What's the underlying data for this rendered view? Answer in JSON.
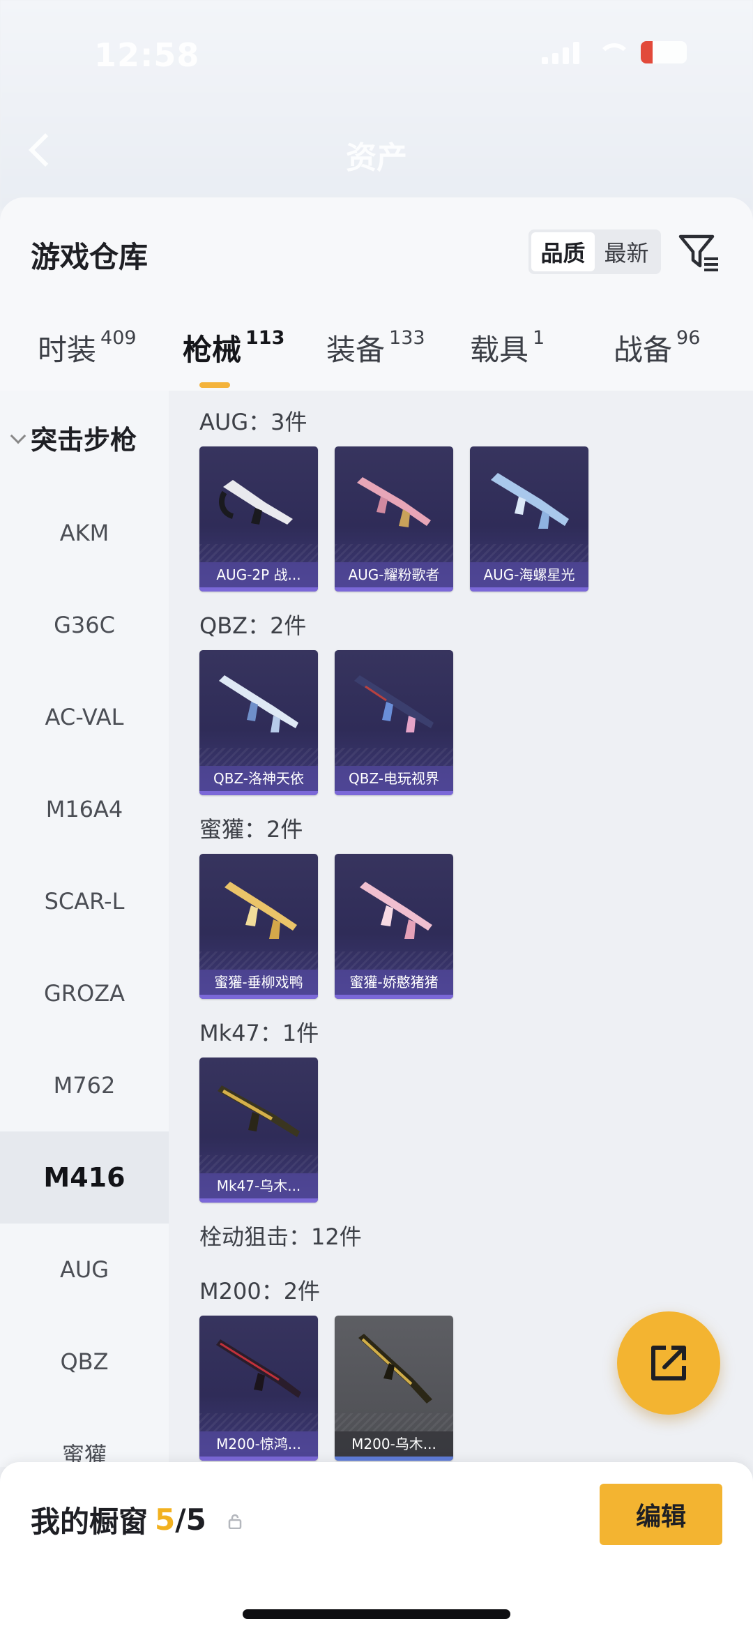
{
  "status_bar": {
    "time": "12:58",
    "battery_label": "20"
  },
  "header": {
    "title": "资产"
  },
  "sheet": {
    "title": "游戏仓库",
    "sort": {
      "options": [
        "品质",
        "最新"
      ],
      "selected": "品质"
    }
  },
  "tabs": [
    {
      "label": "时装",
      "count": "409"
    },
    {
      "label": "枪械",
      "count": "113",
      "active": true
    },
    {
      "label": "装备",
      "count": "133"
    },
    {
      "label": "载具",
      "count": "1"
    },
    {
      "label": "战备",
      "count": "96"
    }
  ],
  "sidebar": {
    "category": "突击步枪",
    "items": [
      "AKM",
      "G36C",
      "AC-VAL",
      "M16A4",
      "SCAR-L",
      "GROZA",
      "M762",
      "M416",
      "AUG",
      "QBZ",
      "蜜獾"
    ],
    "active": "M416"
  },
  "groups": [
    {
      "label": "AUG：3件",
      "items": [
        "AUG-2P 战...",
        "AUG-耀粉歌者",
        "AUG-海螺星光"
      ]
    },
    {
      "label": "QBZ：2件",
      "items": [
        "QBZ-洛神天依",
        "QBZ-电玩视界"
      ]
    },
    {
      "label": "蜜獾：2件",
      "items": [
        "蜜獾-垂柳戏鸭",
        "蜜獾-娇憨猪猪"
      ]
    },
    {
      "label": "Mk47：1件",
      "items": [
        "Mk47-乌木..."
      ]
    },
    {
      "label": "栓动狙击：12件",
      "items": []
    },
    {
      "label": "M200：2件",
      "items": [
        "M200-惊鸿...",
        "M200-乌木..."
      ]
    }
  ],
  "bottom_bar": {
    "label": "我的橱窗",
    "count": "5",
    "total": "/5",
    "edit_label": "编辑"
  },
  "colors": {
    "accent": "#f3b431",
    "card": "#2f2c58",
    "rim": "#7b68d8"
  }
}
